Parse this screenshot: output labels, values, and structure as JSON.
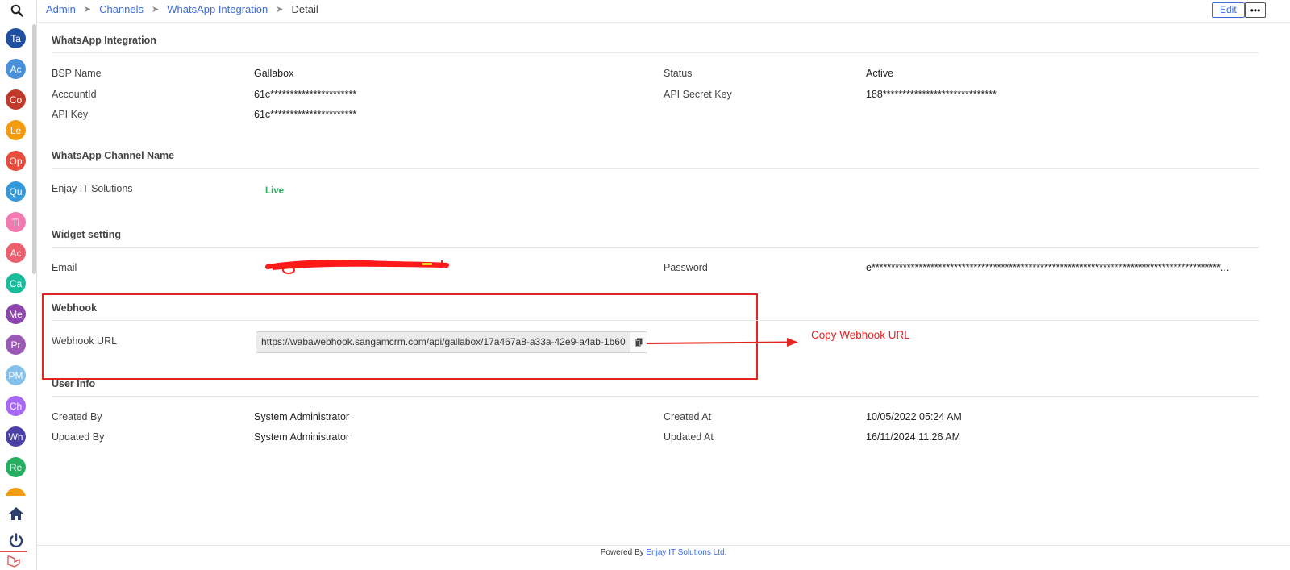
{
  "sidebar": {
    "avatars": [
      {
        "label": "Ta",
        "color": "#1f4fa0"
      },
      {
        "label": "Ac",
        "color": "#4a90d9"
      },
      {
        "label": "Co",
        "color": "#c0392b"
      },
      {
        "label": "Le",
        "color": "#f39c12"
      },
      {
        "label": "Op",
        "color": "#e74c3c"
      },
      {
        "label": "Qu",
        "color": "#3498db"
      },
      {
        "label": "Ti",
        "color": "#f17ab0"
      },
      {
        "label": "Ac",
        "color": "#ec5f6e"
      },
      {
        "label": "Ca",
        "color": "#1abc9c"
      },
      {
        "label": "Me",
        "color": "#8e44ad"
      },
      {
        "label": "Pr",
        "color": "#9b59b6"
      },
      {
        "label": "PM",
        "color": "#85c1e9"
      },
      {
        "label": "Ch",
        "color": "#a569f5"
      },
      {
        "label": "Wh",
        "color": "#4b3fa8"
      },
      {
        "label": "Re",
        "color": "#27ae60"
      },
      {
        "label": "",
        "color": "#f39c12"
      }
    ]
  },
  "breadcrumb": {
    "items": [
      "Admin",
      "Channels",
      "WhatsApp Integration"
    ],
    "current": "Detail"
  },
  "toolbar": {
    "edit_label": "Edit",
    "more_label": "•••"
  },
  "integration": {
    "title": "WhatsApp Integration",
    "bsp_label": "BSP Name",
    "bsp_value": "Gallabox",
    "account_label": "AccountId",
    "account_value": "61c**********************",
    "apikey_label": "API Key",
    "apikey_value": "61c**********************",
    "status_label": "Status",
    "status_value": "Active",
    "secret_label": "API Secret Key",
    "secret_value": "188*****************************"
  },
  "channel": {
    "title": "WhatsApp Channel Name",
    "name": "Enjay IT Solutions",
    "status": "Live"
  },
  "widget": {
    "title": "Widget setting",
    "email_label": "Email",
    "password_label": "Password",
    "password_value": "e*****************************************************************************************..."
  },
  "webhook": {
    "title": "Webhook",
    "url_label": "Webhook URL",
    "url_value": "https://wabawebhook.sangamcrm.com/api/gallabox/17a467a8-a33a-42e9-a4ab-1b60",
    "annotation": "Copy Webhook URL"
  },
  "user_info": {
    "title": "User Info",
    "created_by_label": "Created By",
    "created_by_value": "System Administrator",
    "updated_by_label": "Updated By",
    "updated_by_value": "System Administrator",
    "created_at_label": "Created At",
    "created_at_value": "10/05/2022 05:24 AM",
    "updated_at_label": "Updated At",
    "updated_at_value": "16/11/2024 11:26 AM"
  },
  "footer": {
    "prefix": "Powered By",
    "company": "Enjay IT Solutions Ltd."
  }
}
